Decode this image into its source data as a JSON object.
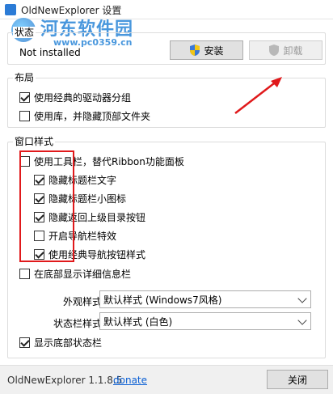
{
  "window": {
    "title": "OldNewExplorer 设置"
  },
  "watermark": {
    "text": "河东软件园",
    "url": "www.pc0359.cn"
  },
  "status_group": {
    "label": "状态",
    "value": "Not installed",
    "install_label": "安装",
    "uninstall_label": "卸载"
  },
  "layout_group": {
    "label": "布局",
    "items": [
      {
        "label": "使用经典的驱动器分组",
        "checked": true
      },
      {
        "label": "使用库，并隐藏顶部文件夹",
        "checked": false
      }
    ]
  },
  "window_style_group": {
    "label": "窗口样式",
    "toolbar_item": {
      "label": "使用工具栏，替代Ribbon功能面板",
      "checked": false
    },
    "sub_items": [
      {
        "label": "隐藏标题栏文字",
        "checked": true
      },
      {
        "label": "隐藏标题栏小图标",
        "checked": true
      },
      {
        "label": "隐藏返回上级目录按钮",
        "checked": true
      },
      {
        "label": "开启导航栏特效",
        "checked": false
      },
      {
        "label": "使用经典导航按钮样式",
        "checked": true
      }
    ],
    "details_item": {
      "label": "在底部显示详细信息栏",
      "checked": false
    },
    "appearance_label": "外观样式：",
    "appearance_value": "默认样式 (Windows7风格)",
    "statusbar_label": "状态栏样式：",
    "statusbar_value": "默认样式 (白色)",
    "show_statusbar_item": {
      "label": "显示底部状态栏",
      "checked": true
    }
  },
  "footer": {
    "version": "OldNewExplorer 1.1.8.5",
    "donate": "donate",
    "close_label": "关闭"
  },
  "colors": {
    "annotation": "#e0191b",
    "link": "#0a5fd4",
    "accent": "#2a86d8"
  },
  "icons": {
    "install": "shield-icon",
    "uninstall": "shield-icon"
  }
}
